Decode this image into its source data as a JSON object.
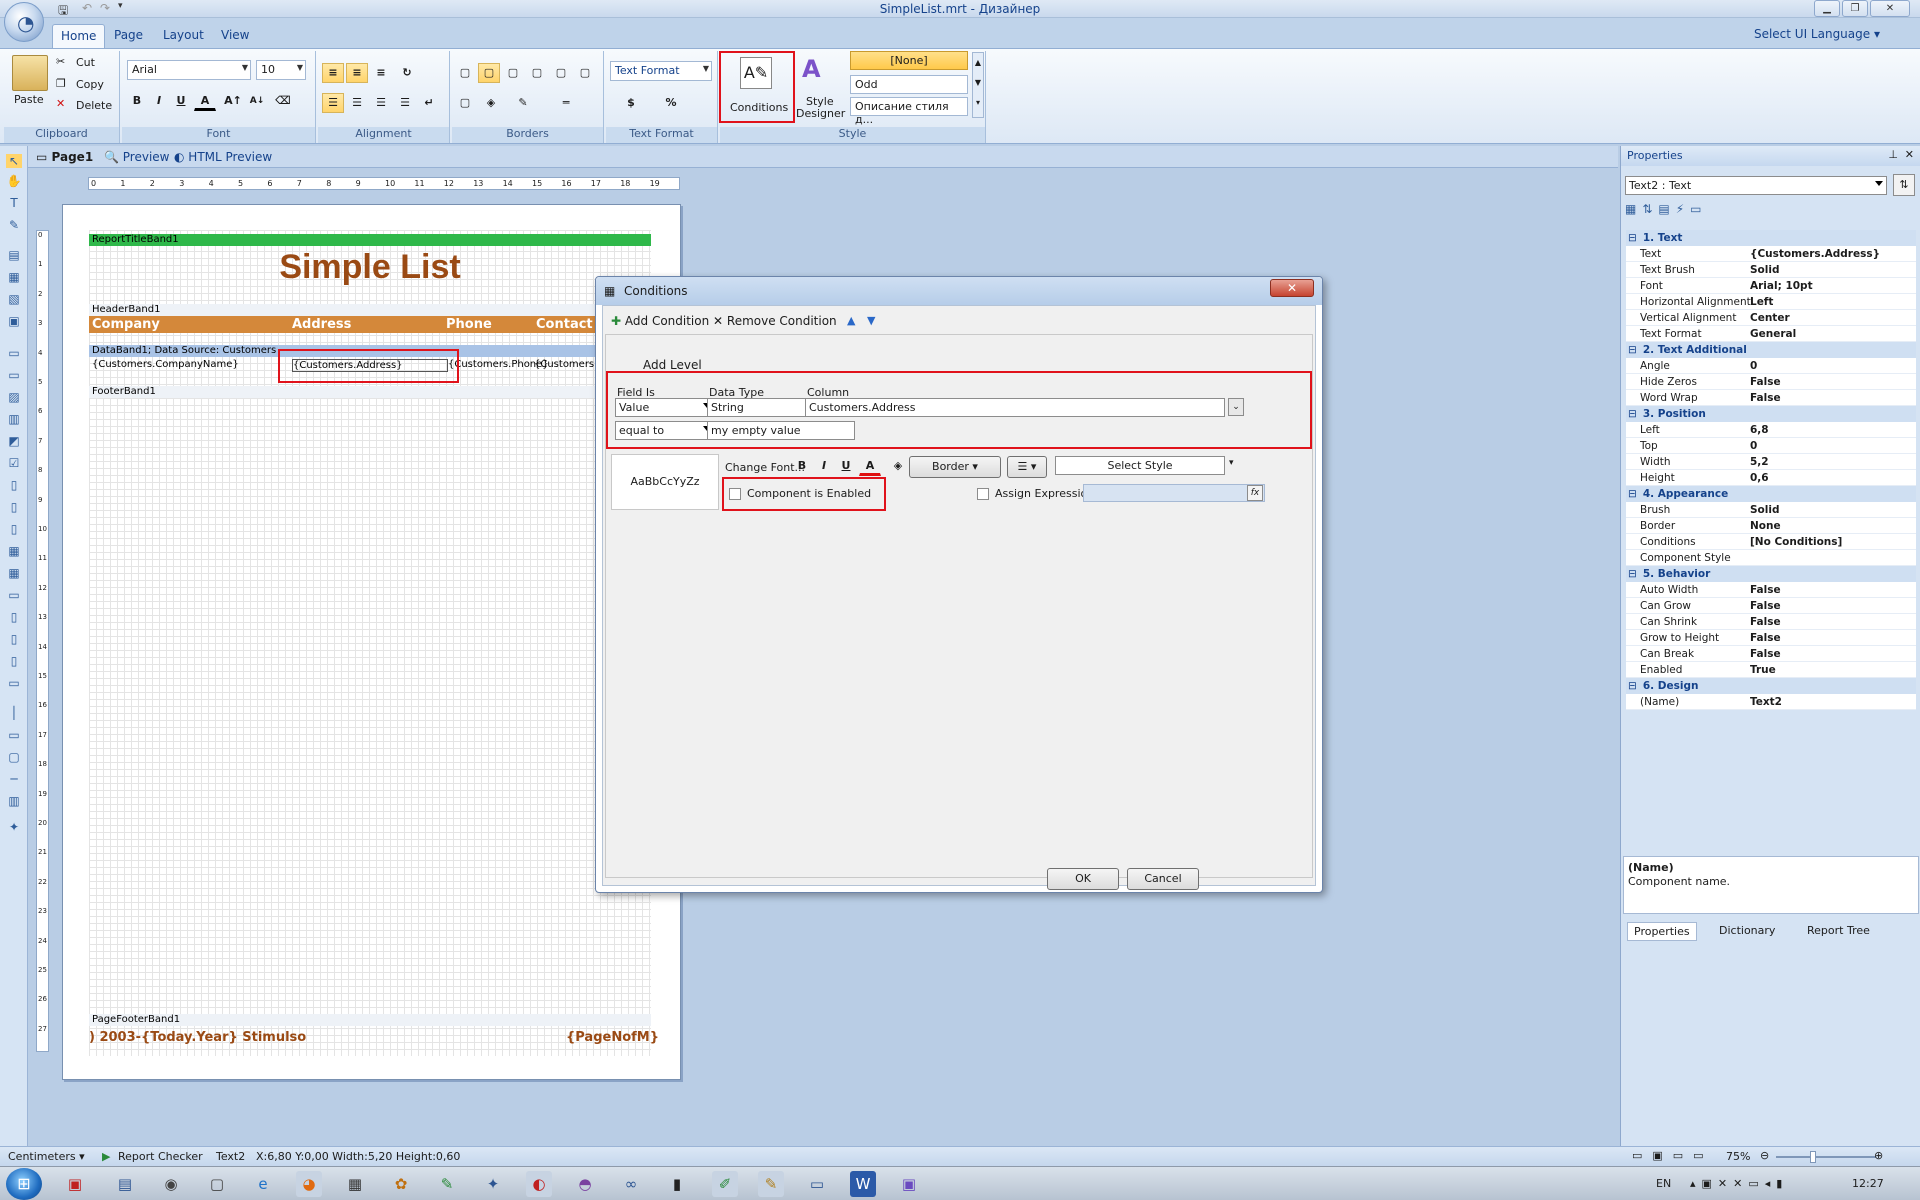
{
  "window": {
    "title": "SimpleList.mrt - Дизайнер"
  },
  "ribbon": {
    "tabs": [
      "Home",
      "Page",
      "Layout",
      "View"
    ],
    "ui_language": "Select UI Language",
    "clipboard": {
      "paste": "Paste",
      "cut": "Cut",
      "copy": "Copy",
      "delete": "Delete",
      "label": "Clipboard"
    },
    "font": {
      "family": "Arial",
      "size": "10",
      "label": "Font"
    },
    "alignment": {
      "label": "Alignment"
    },
    "borders": {
      "label": "Borders"
    },
    "text_format": {
      "value": "Text Format",
      "label": "Text Format"
    },
    "conditions": {
      "label": "Conditions"
    },
    "style_designer": {
      "line1": "Style",
      "line2": "Designer"
    },
    "style": {
      "items": [
        "[None]",
        "Odd",
        "Описание стиля д..."
      ],
      "label": "Style"
    }
  },
  "doc_tabs": [
    "Page1",
    "Preview",
    "HTML Preview"
  ],
  "ruler": [
    "0",
    "1",
    "2",
    "3",
    "4",
    "5",
    "6",
    "7",
    "8",
    "9",
    "10",
    "11",
    "12",
    "13",
    "14",
    "15",
    "16",
    "17",
    "18",
    "19"
  ],
  "ruler_left": [
    "0",
    "1",
    "2",
    "3",
    "4",
    "5",
    "6",
    "7",
    "8",
    "9",
    "10",
    "11",
    "12",
    "13",
    "14",
    "15",
    "16",
    "17",
    "18",
    "19",
    "20",
    "21",
    "22",
    "23",
    "24",
    "25",
    "26",
    "27"
  ],
  "report": {
    "report_title_band": "ReportTitleBand1",
    "title": "Simple List",
    "header_band": "HeaderBand1",
    "headers": [
      "Company",
      "Address",
      "Phone",
      "Contact"
    ],
    "data_band": "DataBand1; Data Source: Customers",
    "cells": [
      "{Customers.CompanyName}",
      "{Customers.Address}",
      "{Customers.Phone}",
      "{Customers.C"
    ],
    "footer_band": "FooterBand1",
    "page_footer_band": "PageFooterBand1",
    "footer_left": ") 2003-{Today.Year} Stimulso",
    "footer_right": "{PageNofM}"
  },
  "dialog": {
    "title": "Conditions",
    "add_condition": "Add Condition",
    "remove_condition": "Remove Condition",
    "add_level": "Add Level",
    "field_is_label": "Field Is",
    "field_is_value": "Value",
    "data_type_label": "Data Type",
    "data_type_value": "String",
    "column_label": "Column",
    "column_value": "Customers.Address",
    "operator_value": "equal to",
    "value_field": "my empty value",
    "sample_text": "AaBbCcYyZz",
    "change_font": "Change Font...",
    "border": "Border",
    "select_style": "Select Style",
    "component_enabled": "Component is Enabled",
    "assign_expression": "Assign Expression",
    "ok": "OK",
    "cancel": "Cancel"
  },
  "properties": {
    "title": "Properties",
    "selected": "Text2 : Text",
    "rows": [
      {
        "cat": "1. Text"
      },
      {
        "k": "Text",
        "v": "{Customers.Address}"
      },
      {
        "k": "Text Brush",
        "v": "Solid"
      },
      {
        "k": "Font",
        "v": "Arial; 10pt"
      },
      {
        "k": "Horizontal Alignment",
        "v": "Left"
      },
      {
        "k": "Vertical Alignment",
        "v": "Center"
      },
      {
        "k": "Text Format",
        "v": "General"
      },
      {
        "cat": "2. Text  Additional"
      },
      {
        "k": "Angle",
        "v": "0"
      },
      {
        "k": "Hide Zeros",
        "v": "False"
      },
      {
        "k": "Word Wrap",
        "v": "False"
      },
      {
        "cat": "3. Position"
      },
      {
        "k": "Left",
        "v": "6,8"
      },
      {
        "k": "Top",
        "v": "0"
      },
      {
        "k": "Width",
        "v": "5,2"
      },
      {
        "k": "Height",
        "v": "0,6"
      },
      {
        "cat": "4. Appearance"
      },
      {
        "k": "Brush",
        "v": "Solid"
      },
      {
        "k": "Border",
        "v": "None"
      },
      {
        "k": "Conditions",
        "v": "[No Conditions]"
      },
      {
        "k": "Component Style",
        "v": ""
      },
      {
        "cat": "5. Behavior"
      },
      {
        "k": "Auto Width",
        "v": "False"
      },
      {
        "k": "Can Grow",
        "v": "False"
      },
      {
        "k": "Can Shrink",
        "v": "False"
      },
      {
        "k": "Grow to Height",
        "v": "False"
      },
      {
        "k": "Can Break",
        "v": "False"
      },
      {
        "k": "Enabled",
        "v": "True"
      },
      {
        "cat": "6. Design"
      },
      {
        "k": "(Name)",
        "v": "Text2"
      }
    ],
    "desc_title": "(Name)",
    "desc_text": "Component name.",
    "tabs": [
      "Properties",
      "Dictionary",
      "Report Tree"
    ]
  },
  "status": {
    "units": "Centimeters",
    "checker": "Report Checker",
    "component": "Text2",
    "coords": "X:6,80  Y:0,00  Width:5,20  Height:0,60",
    "zoom": "75%"
  },
  "taskbar": {
    "lang": "EN",
    "time": "12:27"
  }
}
